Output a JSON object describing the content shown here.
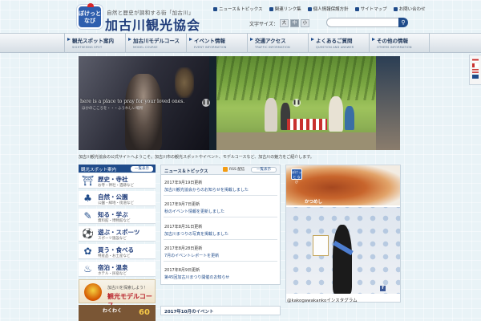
{
  "header": {
    "logo_badge_text": "ぼけっと\nなび",
    "tagline": "自然と歴史が調和する街「加古川」",
    "site_title": "加古川観光協会",
    "links": [
      {
        "label": "ニュース＆トピックス",
        "color": "#1f4b8a"
      },
      {
        "label": "関連リンク集",
        "color": "#1f4b8a"
      },
      {
        "label": "個人情報保護方針",
        "color": "#1f4b8a"
      },
      {
        "label": "サイトマップ",
        "color": "#1f4b8a"
      },
      {
        "label": "お問い合わせ",
        "color": "#1f4b8a"
      }
    ],
    "font_size_label": "文字サイズ：",
    "font_sizes": [
      "大",
      "中",
      "小"
    ],
    "search_placeholder": "",
    "search_icon": "search-icon"
  },
  "nav": [
    {
      "label": "観光スポット案内",
      "sub": "SIGHTSEEING SPOT"
    },
    {
      "label": "加古川モデルコース",
      "sub": "MODEL COURSE"
    },
    {
      "label": "イベント情報",
      "sub": "EVENT INFORMATION"
    },
    {
      "label": "交通アクセス",
      "sub": "TRAFFIC INFORMATION"
    },
    {
      "label": "よくあるご質問",
      "sub": "QUESTION AND ANSWER"
    },
    {
      "label": "その他の情報",
      "sub": "OTHERS INFORMATION"
    }
  ],
  "hero": {
    "caption_en": "here is a place to pray for your loved ones.",
    "caption_ja": "ほかのこころを・・・ふうれしい場所",
    "prev_label": "❚❚",
    "next_label": "❚❚"
  },
  "intro_text": "加古川観光協会の公式サイトへようこそ。加古川市の観光スポットやイベント、モデルコースなど、加古川の魅力をご紹介します。",
  "sidebar": {
    "title": "観光スポット案内",
    "more": "一覧表示",
    "items": [
      {
        "title": "歴史・寺社",
        "sub": "お寺・神社・遺跡など",
        "icon": "⛩"
      },
      {
        "title": "自然・公園",
        "sub": "公園・緑地・街道など",
        "icon": "♣"
      },
      {
        "title": "知る・学ぶ",
        "sub": "資料館・博物館など",
        "icon": "✎"
      },
      {
        "title": "遊ぶ・スポーツ",
        "sub": "スポーツ施設など",
        "icon": "⚽"
      },
      {
        "title": "買う・食べる",
        "sub": "特産品・お土産など",
        "icon": "✿"
      },
      {
        "title": "宿泊・温泉",
        "sub": "ホテル・民宿など",
        "icon": "♨"
      }
    ],
    "banner_course_line1": "加古川を探索しよう！",
    "banner_course_line2": "観光モデルコース",
    "banner_walk_line1": "わくわく",
    "banner_walk_num": "60"
  },
  "news": {
    "title": "ニュース＆トピックス",
    "rss_label": "RSS 配信",
    "more": "一覧表示",
    "items": [
      {
        "date": "2017年9月19日更新",
        "title": "加古川観光協会からのお知らせを掲載しました"
      },
      {
        "date": "2017年9月7日更新",
        "title": "秋のイベント情報を更新しました"
      },
      {
        "date": "2017年8月31日更新",
        "title": "加古川まつりの写真を掲載しました"
      },
      {
        "date": "2017年8月28日更新",
        "title": "7月のイベントレポートを更新"
      },
      {
        "date": "2017年8月9日更新",
        "title": "第45回加古川まつり開催のお知らせ"
      }
    ],
    "section2_title": "2017年10月のイベント",
    "section2_item": ""
  },
  "media": {
    "badge_text": "ぼけっと なび",
    "food_caption": "かつめし",
    "instagram_caption": "@kakogawakankoインスタグラム"
  },
  "lang_flags": [
    "#c8312f",
    "#1f4b8a",
    "#c8312f",
    "#2d7a2d"
  ]
}
